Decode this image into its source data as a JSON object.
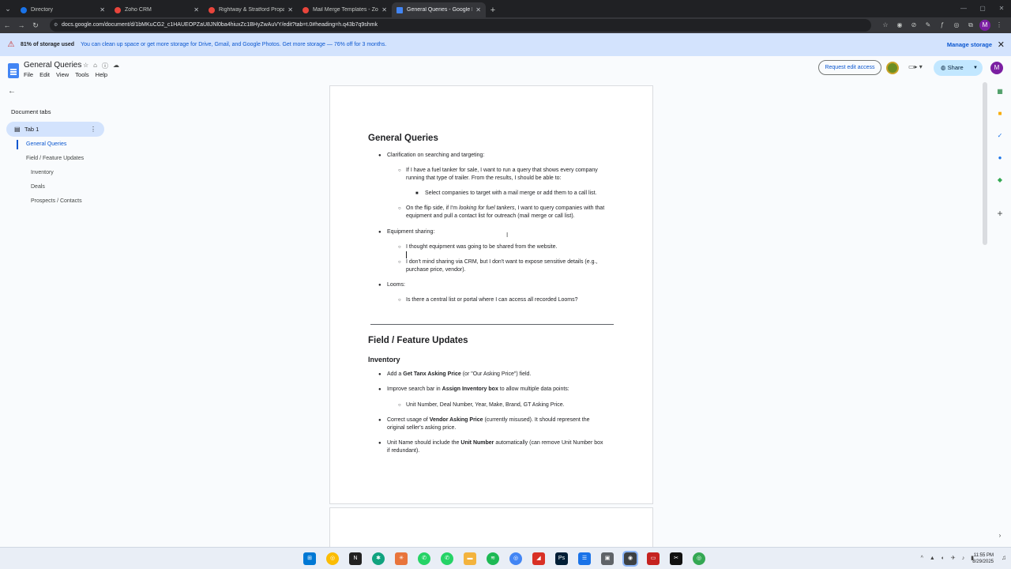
{
  "browser": {
    "tabs": [
      {
        "title": "Directory",
        "fav_color": "#1a73e8"
      },
      {
        "title": "Zoho CRM",
        "fav_color": "#e8453c"
      },
      {
        "title": "Rightway & Stratford Propane",
        "fav_color": "#e8453c"
      },
      {
        "title": "Mail Merge Templates - Zoho",
        "fav_color": "#e8453c"
      },
      {
        "title": "General Queries - Google Docs",
        "fav_color": "#4285f4"
      }
    ],
    "url": "docs.google.com/document/d/1bMKuCG2_c1HAUEOPZaU8JNl0ba4hiuxZc1BHyZwAuVY/edit?tab=t.0#heading=h.q43b7q9shmk",
    "profile_initial": "M"
  },
  "banner": {
    "strong": "81% of storage used",
    "message": "You can clean up space or get more storage for Drive, Gmail, and Google Photos. Get more storage — 76% off for 3 months.",
    "manage": "Manage storage"
  },
  "docs": {
    "title": "General Queries",
    "menu": [
      "File",
      "Edit",
      "View",
      "Tools",
      "Help"
    ],
    "request_edit": "Request edit access",
    "share": "Share",
    "account_initial": "M"
  },
  "outline": {
    "heading": "Document tabs",
    "tab": "Tab 1",
    "items": [
      "General Queries",
      "Field / Feature Updates",
      "Inventory",
      "Deals",
      "Prospects / Contacts"
    ]
  },
  "content": {
    "h1_general": "General Queries",
    "clarification": "Clarification on searching and targeting:",
    "fuel_1": "If I have a fuel tanker for sale, I want to run a query that shows every company",
    "fuel_2": "running that type of trailer. From the results, I should be able to:",
    "select": "Select companies to target with a mail merge or add them to a call list.",
    "flip_a": "On the flip side, if I'm ",
    "flip_em": "looking for fuel tankers",
    "flip_b": ", I want to query companies with that",
    "flip_2": "equipment and pull a contact list for outreach (mail merge or call list).",
    "equip": "Equipment sharing:",
    "thought": "I thought equipment was going to be shared from the website.",
    "mind_1": "I don't mind sharing via CRM, but I don't want to expose sensitive details (e.g.,",
    "mind_2": "purchase price, vendor).",
    "looms": "Looms:",
    "central": "Is there a central list or portal where I can access all recorded Looms?",
    "h1_field": "Field / Feature Updates",
    "h2_inventory": "Inventory",
    "add_a": "Add a ",
    "add_b": "Get Tanx Asking Price",
    "add_c": " (or \"Our Asking Price\") field.",
    "improve_a": "Improve search bar in ",
    "improve_b": "Assign Inventory box",
    "improve_c": " to allow multiple data points:",
    "unit_list": "Unit Number, Deal Number, Year, Make, Brand, GT Asking Price.",
    "correct_a": "Correct usage of ",
    "correct_b": "Vendor Asking Price",
    "correct_c": " (currently misused). It should represent the",
    "correct_2": "original seller's asking price.",
    "unit_a": "Unit Name should include the ",
    "unit_b": "Unit Number",
    "unit_c": " automatically (can remove Unit Number box",
    "unit_2": "if redundant)."
  },
  "taskbar": {
    "time": "11:55 PM",
    "date": "8/29/2025"
  }
}
